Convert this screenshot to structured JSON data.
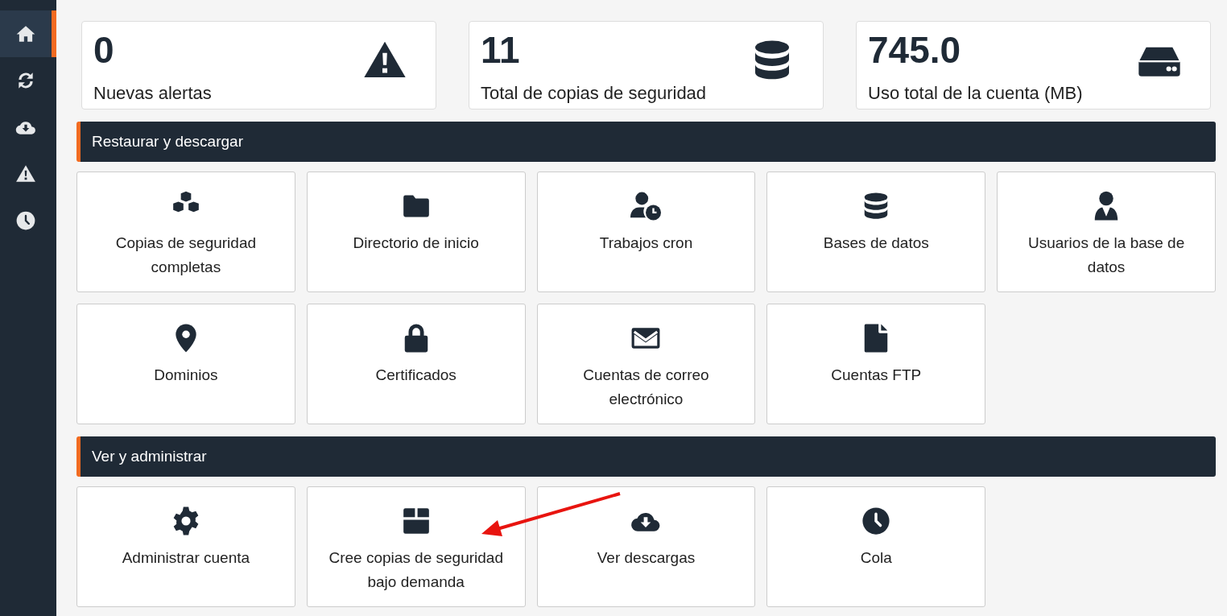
{
  "sidebar": {
    "items": [
      {
        "selected": true
      },
      {
        "selected": false
      },
      {
        "selected": false
      },
      {
        "selected": false
      },
      {
        "selected": false
      }
    ]
  },
  "stats": [
    {
      "value": "0",
      "label": "Nuevas alertas"
    },
    {
      "value": "11",
      "label": "Total de copias de seguridad"
    },
    {
      "value": "745.0",
      "label": "Uso total de la cuenta (MB)"
    }
  ],
  "sections": [
    {
      "title": "Restaurar y descargar",
      "tiles": [
        "Copias de seguridad completas",
        "Directorio de inicio",
        "Trabajos cron",
        "Bases de datos",
        "Usuarios de la base de datos",
        "Dominios",
        "Certificados",
        "Cuentas de correo electrónico",
        "Cuentas FTP"
      ]
    },
    {
      "title": "Ver y administrar",
      "tiles": [
        "Administrar cuenta",
        "Cree copias de seguridad bajo demanda",
        "Ver descargas",
        "Cola"
      ]
    }
  ]
}
